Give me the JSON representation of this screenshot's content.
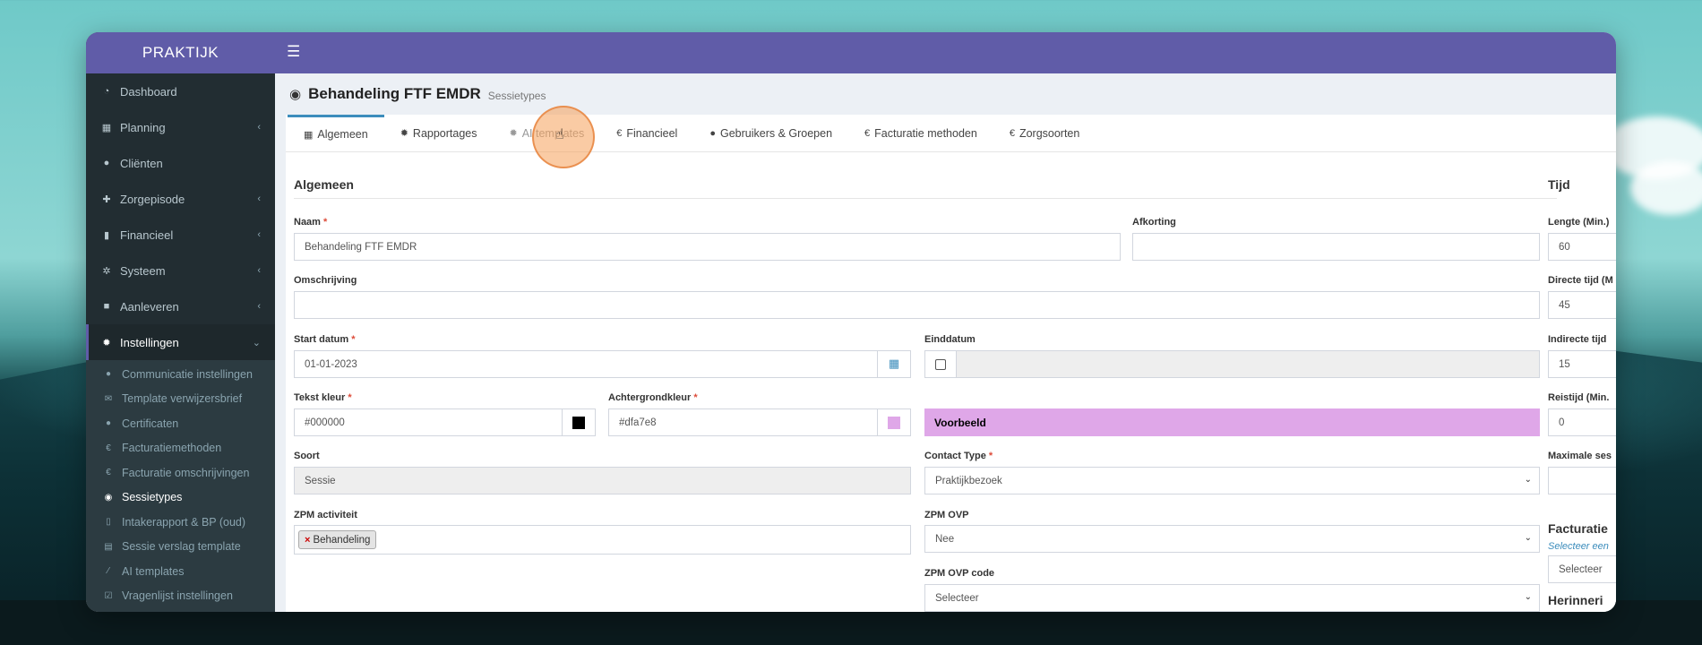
{
  "app": {
    "brand": "PRAKTIJK",
    "menu_icon": "hamburger-icon"
  },
  "sidebar": {
    "items": [
      {
        "label": "Dashboard",
        "icon": "dashboard-icon"
      },
      {
        "label": "Planning",
        "icon": "calendar-icon",
        "chevron": "‹"
      },
      {
        "label": "Cliënten",
        "icon": "user-icon"
      },
      {
        "label": "Zorgepisode",
        "icon": "medkit-icon",
        "chevron": "‹"
      },
      {
        "label": "Financieel",
        "icon": "book-icon",
        "chevron": "‹"
      },
      {
        "label": "Systeem",
        "icon": "cogs-icon",
        "chevron": "‹"
      },
      {
        "label": "Aanleveren",
        "icon": "truck-icon",
        "chevron": "‹"
      },
      {
        "label": "Instellingen",
        "icon": "gear-icon",
        "chevron": "⌄"
      }
    ],
    "subitems": [
      {
        "label": "Communicatie instellingen",
        "icon": "comments-icon"
      },
      {
        "label": "Template verwijzersbrief",
        "icon": "envelope-icon"
      },
      {
        "label": "Certificaten",
        "icon": "certificate-icon"
      },
      {
        "label": "Facturatiemethoden",
        "icon": "euro-icon"
      },
      {
        "label": "Facturatie omschrijvingen",
        "icon": "euro-icon"
      },
      {
        "label": "Sessietypes",
        "icon": "globe-icon"
      },
      {
        "label": "Intakerapport & BP (oud)",
        "icon": "file-icon"
      },
      {
        "label": "Sessie verslag template",
        "icon": "database-icon"
      },
      {
        "label": "AI templates",
        "icon": "magic-icon"
      },
      {
        "label": "Vragenlijst instellingen",
        "icon": "check-square-icon"
      }
    ]
  },
  "page": {
    "title": "Behandeling FTF EMDR",
    "subtitle": "Sessietypes"
  },
  "tabs": [
    {
      "label": "Algemeen",
      "icon": "table-icon"
    },
    {
      "label": "Rapportages",
      "icon": "gear-icon"
    },
    {
      "label": "AI templates",
      "icon": "gear-icon"
    },
    {
      "label": "Financieel",
      "icon": "euro-icon"
    },
    {
      "label": "Gebruikers & Groepen",
      "icon": "user-icon"
    },
    {
      "label": "Facturatie methoden",
      "icon": "euro-icon"
    },
    {
      "label": "Zorgsoorten",
      "icon": "euro-icon"
    }
  ],
  "form": {
    "section_general": "Algemeen",
    "section_time": "Tijd",
    "naam_label": "Naam",
    "naam_value": "Behandeling FTF EMDR",
    "afkorting_label": "Afkorting",
    "afkorting_value": "",
    "omschrijving_label": "Omschrijving",
    "omschrijving_value": "",
    "start_label": "Start datum",
    "start_value": "01-01-2023",
    "eind_label": "Einddatum",
    "eind_value": "",
    "tekstkleur_label": "Tekst kleur",
    "tekstkleur_value": "#000000",
    "achtergrond_label": "Achtergrondkleur",
    "achtergrond_value": "#dfa7e8",
    "preview_text": "Voorbeeld",
    "soort_label": "Soort",
    "soort_value": "Sessie",
    "contact_label": "Contact Type",
    "contact_value": "Praktijkbezoek",
    "zpm_act_label": "ZPM activiteit",
    "zpm_tag": "Behandeling",
    "zpm_ovp_label": "ZPM OVP",
    "zpm_ovp_value": "Nee",
    "zpm_ovp_code_label": "ZPM OVP code",
    "zpm_ovp_code_value": "Selecteer",
    "required_mark": "*"
  },
  "time": {
    "lengte_label": "Lengte (Min.)",
    "lengte_value": "60",
    "directe_label": "Directe tijd (M",
    "directe_value": "45",
    "indirecte_label": "Indirecte tijd",
    "indirecte_value": "15",
    "reistijd_label": "Reistijd (Min.",
    "reistijd_value": "0",
    "max_label": "Maximale ses",
    "max_value": "",
    "facturatie_title": "Facturatie",
    "facturatie_link": "Selecteer een",
    "facturatie_select": "Selecteer",
    "herinnering_title": "Herinneri"
  },
  "colors": {
    "accent": "#605ca8",
    "sidebar_bg": "#222d32",
    "tab_active": "#3c8dbc",
    "text_color_swatch": "#000000",
    "background_color_swatch": "#dfa7e8"
  }
}
